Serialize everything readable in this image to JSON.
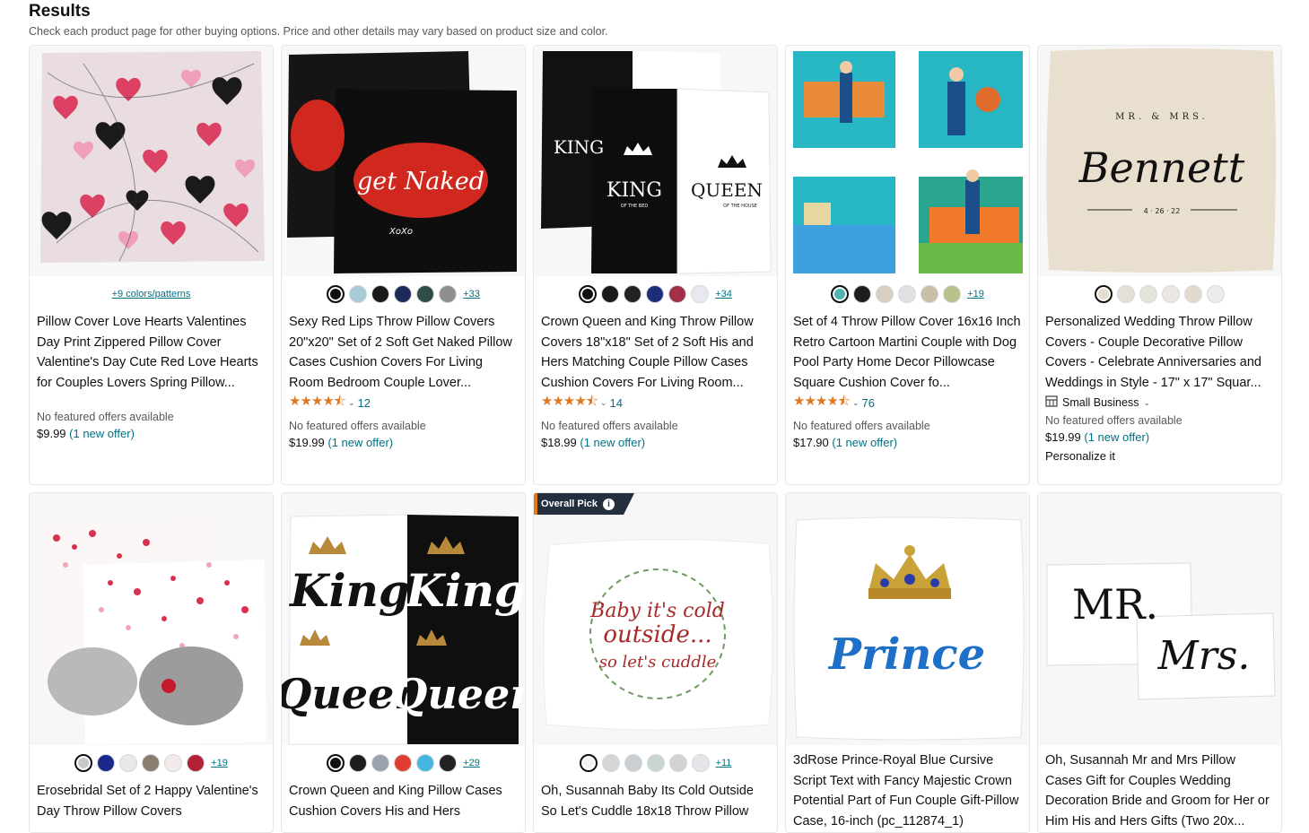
{
  "header": {
    "title": "Results",
    "subtitle": "Check each product page for other buying options. Price and other details may vary based on product size and color."
  },
  "products": [
    {
      "title": "Pillow Cover Love Hearts Valentines Day Print Zippered Pillow Cover Valentine's Day Cute Red Love Hearts for Couples Lovers Spring Pillow...",
      "colors_link": "+9 colors/patterns",
      "offers": "No featured offers available",
      "price": "$9.99",
      "offer_link": "(1 new offer)"
    },
    {
      "title": "Sexy Red Lips Throw Pillow Covers 20\"x20\" Set of 2 Soft Get Naked Pillow Cases Cushion Covers For Living Room Bedroom Couple Lover...",
      "swatch_colors": [
        "#111111",
        "#a7cbd6",
        "#1b1b1b",
        "#1f2a5c",
        "#2f4d4a",
        "#8e8e8e"
      ],
      "more": "+33",
      "rating": 4.5,
      "reviews": "12",
      "offers": "No featured offers available",
      "price": "$19.99",
      "offer_link": "(1 new offer)"
    },
    {
      "title": "Crown Queen and King Throw Pillow Covers 18\"x18\" Set of 2 Soft His and Hers Matching Couple Pillow Cases Cushion Covers For Living Room...",
      "swatch_colors": [
        "#111111",
        "#1b1b1b",
        "#222222",
        "#1f2c7a",
        "#a0304a",
        "#e8e8f2"
      ],
      "more": "+34",
      "rating": 4.5,
      "reviews": "14",
      "offers": "No featured offers available",
      "price": "$18.99",
      "offer_link": "(1 new offer)"
    },
    {
      "title": "Set of 4 Throw Pillow Cover 16x16 Inch Retro Cartoon Martini Couple with Dog Pool Party Home Decor Pillowcase Square Cushion Cover fo...",
      "swatch_colors": [
        "#4fb3b3",
        "#1e1e1e",
        "#d8cfc3",
        "#e1e1e1",
        "#c9bea6",
        "#b9c08a"
      ],
      "more": "+19",
      "rating": 4.5,
      "reviews": "76",
      "offers": "No featured offers available",
      "price": "$17.90",
      "offer_link": "(1 new offer)"
    },
    {
      "title": "Personalized Wedding Throw Pillow Covers - Couple Decorative Pillow Covers - Celebrate Anniversaries and Weddings in Style - 17\" x 17\" Squar...",
      "swatch_colors": [
        "#e5ddd0",
        "#e4dfd8",
        "#e6e3dc",
        "#ebe8e2",
        "#e2dacd",
        "#ececec"
      ],
      "small_business": "Small Business",
      "offers": "No featured offers available",
      "price": "$19.99",
      "offer_link": "(1 new offer)",
      "personalize": "Personalize it"
    },
    {
      "title": "Erosebridal Set of 2 Happy Valentine's Day Throw Pillow Covers",
      "swatch_colors": [
        "#c8c8c8",
        "#1a2a8a",
        "#e8e8e8",
        "#8a7d6e",
        "#f3e9ea",
        "#b21f36"
      ],
      "more": "+19"
    },
    {
      "title": "Crown Queen and King Pillow Cases Cushion Covers His and Hers",
      "swatch_colors": [
        "#111111",
        "#1e1e1e",
        "#9aa3ad",
        "#e03c31",
        "#45b6e0",
        "#222222"
      ],
      "more": "+29"
    },
    {
      "badge": "Overall Pick",
      "title": "Oh, Susannah Baby Its Cold Outside So Let's Cuddle 18x18 Throw Pillow",
      "swatch_colors": [
        "#f2f2f2",
        "#d6d6d6",
        "#c9cfd2",
        "#c7d4cf",
        "#d3d3d3",
        "#e6e6ea"
      ],
      "more": "+11"
    },
    {
      "title": "3dRose Prince-Royal Blue Cursive Script Text with Fancy Majestic Crown Potential Part of Fun Couple Gift-Pillow Case, 16-inch (pc_112874_1)"
    },
    {
      "title": "Oh, Susannah Mr and Mrs Pillow Cases Gift for Couples Wedding Decoration Bride and Groom for Her or Him His and Hers Gifts (Two 20x..."
    }
  ],
  "image_text": {
    "lips": "get Naked",
    "lips_brand": "XoXo",
    "king": "KING",
    "king_sub": "OF THE BED",
    "queen": "QUEEN",
    "queen_sub": "OF THE HOUSE",
    "mr_mrs": "MR. & MRS.",
    "bennett": "Bennett",
    "bennett_date": "4 · 26 · 22",
    "king2": "King",
    "queen2": "Queen",
    "baby1": "Baby it's cold",
    "baby2": "outside...",
    "baby3": "so let's cuddle",
    "prince": "Prince",
    "mr": "MR.",
    "mrs": "Mrs."
  },
  "colors": {
    "link": "#007185",
    "star": "#de7921",
    "badge_bg": "#232f3e"
  }
}
